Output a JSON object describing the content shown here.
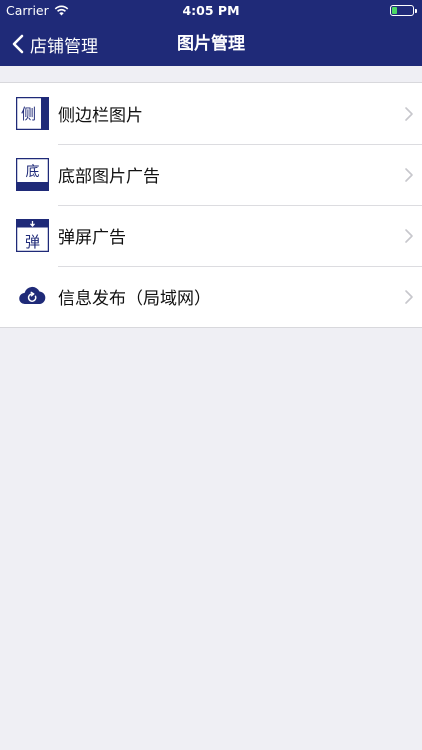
{
  "status_bar": {
    "carrier": "Carrier",
    "time": "4:05 PM",
    "battery_level": 0.25,
    "battery_color": "#4cd964"
  },
  "nav": {
    "back_label": "店铺管理",
    "title": "图片管理",
    "background_color": "#1f2a78"
  },
  "menu": {
    "items": [
      {
        "label": "侧边栏图片",
        "icon_char": "侧",
        "icon": "sidebar-image-icon"
      },
      {
        "label": "底部图片广告",
        "icon_char": "底",
        "icon": "bottom-ad-icon"
      },
      {
        "label": "弹屏广告",
        "icon_char": "弹",
        "icon": "popup-ad-icon"
      },
      {
        "label": "信息发布（局域网）",
        "icon": "cloud-sync-icon"
      }
    ]
  }
}
